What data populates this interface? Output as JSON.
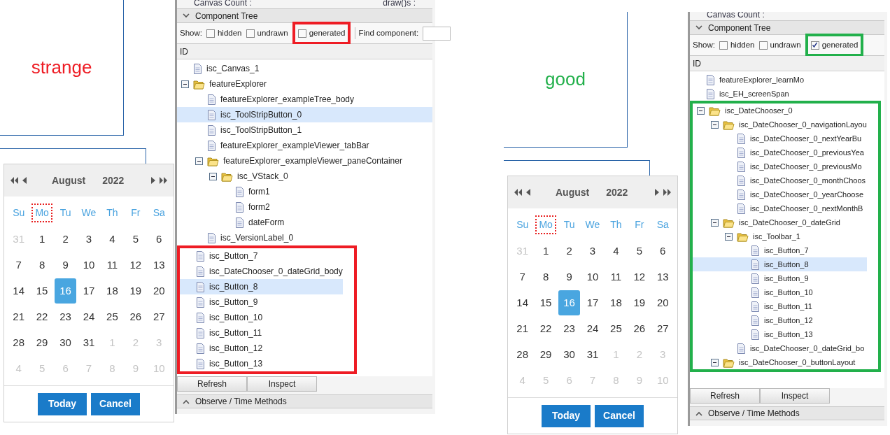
{
  "panels": [
    {
      "caption": {
        "text": "strange"
      },
      "color": "#ee1c24",
      "calendar": {
        "month": "August",
        "year": "2022",
        "weekdays": [
          {
            "label": "Su",
            "focused": false
          },
          {
            "label": "Mo",
            "focused": true
          },
          {
            "label": "Tu",
            "focused": false
          },
          {
            "label": "We",
            "focused": false
          },
          {
            "label": "Th",
            "focused": false
          },
          {
            "label": "Fr",
            "focused": false
          },
          {
            "label": "Sa",
            "focused": false
          }
        ],
        "weeks": [
          [
            {
              "day": "31",
              "other_month": true,
              "selected": false
            },
            {
              "day": "1",
              "other_month": false,
              "selected": false
            },
            {
              "day": "2",
              "other_month": false,
              "selected": false
            },
            {
              "day": "3",
              "other_month": false,
              "selected": false
            },
            {
              "day": "4",
              "other_month": false,
              "selected": false
            },
            {
              "day": "5",
              "other_month": false,
              "selected": false
            },
            {
              "day": "6",
              "other_month": false,
              "selected": false
            }
          ],
          [
            {
              "day": "7",
              "other_month": false,
              "selected": false
            },
            {
              "day": "8",
              "other_month": false,
              "selected": false
            },
            {
              "day": "9",
              "other_month": false,
              "selected": false
            },
            {
              "day": "10",
              "other_month": false,
              "selected": false
            },
            {
              "day": "11",
              "other_month": false,
              "selected": false
            },
            {
              "day": "12",
              "other_month": false,
              "selected": false
            },
            {
              "day": "13",
              "other_month": false,
              "selected": false
            }
          ],
          [
            {
              "day": "14",
              "other_month": false,
              "selected": false
            },
            {
              "day": "15",
              "other_month": false,
              "selected": false
            },
            {
              "day": "16",
              "other_month": false,
              "selected": true
            },
            {
              "day": "17",
              "other_month": false,
              "selected": false
            },
            {
              "day": "18",
              "other_month": false,
              "selected": false
            },
            {
              "day": "19",
              "other_month": false,
              "selected": false
            },
            {
              "day": "20",
              "other_month": false,
              "selected": false
            }
          ],
          [
            {
              "day": "21",
              "other_month": false,
              "selected": false
            },
            {
              "day": "22",
              "other_month": false,
              "selected": false
            },
            {
              "day": "23",
              "other_month": false,
              "selected": false
            },
            {
              "day": "24",
              "other_month": false,
              "selected": false
            },
            {
              "day": "25",
              "other_month": false,
              "selected": false
            },
            {
              "day": "26",
              "other_month": false,
              "selected": false
            },
            {
              "day": "27",
              "other_month": false,
              "selected": false
            }
          ],
          [
            {
              "day": "28",
              "other_month": false,
              "selected": false
            },
            {
              "day": "29",
              "other_month": false,
              "selected": false
            },
            {
              "day": "30",
              "other_month": false,
              "selected": false
            },
            {
              "day": "31",
              "other_month": false,
              "selected": false
            },
            {
              "day": "1",
              "other_month": true,
              "selected": false
            },
            {
              "day": "2",
              "other_month": true,
              "selected": false
            },
            {
              "day": "3",
              "other_month": true,
              "selected": false
            }
          ],
          [
            {
              "day": "4",
              "other_month": true,
              "selected": false
            },
            {
              "day": "5",
              "other_month": true,
              "selected": false
            },
            {
              "day": "6",
              "other_month": true,
              "selected": false
            },
            {
              "day": "7",
              "other_month": true,
              "selected": false
            },
            {
              "day": "8",
              "other_month": true,
              "selected": false
            },
            {
              "day": "9",
              "other_month": true,
              "selected": false
            },
            {
              "day": "10",
              "other_month": true,
              "selected": false
            }
          ]
        ],
        "buttons": [
          "Today",
          "Cancel"
        ]
      },
      "inspector": {
        "top_labels": [
          "Canvas Count :",
          "draw()s :"
        ],
        "section": "Component Tree",
        "show_label": "Show:",
        "show_options": [
          {
            "label": "hidden",
            "checked": false,
            "annotated": false
          },
          {
            "label": "undrawn",
            "checked": false,
            "annotated": false
          },
          {
            "label": "generated",
            "checked": false,
            "annotated": true
          }
        ],
        "find_label": "Find component:",
        "column": "ID",
        "tree": [
          {
            "label": "isc_Canvas_1",
            "kind": "leaf",
            "selected": false,
            "annotated": false
          },
          {
            "label": "featureExplorer",
            "kind": "folder",
            "expanded": true,
            "selected": false,
            "annotated": false,
            "children": [
              {
                "label": "featureExplorer_exampleTree_body",
                "kind": "leaf",
                "selected": false
              },
              {
                "label": "isc_ToolStripButton_0",
                "kind": "leaf",
                "selected": true
              },
              {
                "label": "isc_ToolStripButton_1",
                "kind": "leaf",
                "selected": false
              },
              {
                "label": "featureExplorer_exampleViewer_tabBar",
                "kind": "leaf",
                "selected": false
              },
              {
                "label": "featureExplorer_exampleViewer_paneContainer",
                "kind": "folder",
                "expanded": true,
                "selected": false,
                "children": [
                  {
                    "label": "isc_VStack_0",
                    "kind": "folder",
                    "expanded": true,
                    "selected": false,
                    "children": [
                      {
                        "label": "form1",
                        "kind": "leaf",
                        "selected": false
                      },
                      {
                        "label": "form2",
                        "kind": "leaf",
                        "selected": false
                      },
                      {
                        "label": "dateForm",
                        "kind": "leaf",
                        "selected": false
                      }
                    ]
                  }
                ]
              },
              {
                "label": "isc_VersionLabel_0",
                "kind": "leaf",
                "selected": false
              }
            ]
          },
          {
            "label": "isc_Button_7",
            "kind": "leaf",
            "selected": false,
            "annotated": true
          },
          {
            "label": "isc_DateChooser_0_dateGrid_body",
            "kind": "leaf",
            "selected": false,
            "annotated": true
          },
          {
            "label": "isc_Button_8",
            "kind": "leaf",
            "selected": true,
            "annotated": true
          },
          {
            "label": "isc_Button_9",
            "kind": "leaf",
            "selected": false,
            "annotated": true
          },
          {
            "label": "isc_Button_10",
            "kind": "leaf",
            "selected": false,
            "annotated": true
          },
          {
            "label": "isc_Button_11",
            "kind": "leaf",
            "selected": false,
            "annotated": true
          },
          {
            "label": "isc_Button_12",
            "kind": "leaf",
            "selected": false,
            "annotated": true
          },
          {
            "label": "isc_Button_13",
            "kind": "leaf",
            "selected": false,
            "annotated": true
          }
        ],
        "buttons": [
          "Refresh",
          "Inspect"
        ],
        "footer_section": "Observe / Time Methods"
      }
    },
    {
      "caption": {
        "text": "good"
      },
      "color": "#22b04b",
      "calendar": {
        "month": "August",
        "year": "2022",
        "weekdays": [
          {
            "label": "Su",
            "focused": false
          },
          {
            "label": "Mo",
            "focused": true
          },
          {
            "label": "Tu",
            "focused": false
          },
          {
            "label": "We",
            "focused": false
          },
          {
            "label": "Th",
            "focused": false
          },
          {
            "label": "Fr",
            "focused": false
          },
          {
            "label": "Sa",
            "focused": false
          }
        ],
        "weeks": [
          [
            {
              "day": "31",
              "other_month": true,
              "selected": false
            },
            {
              "day": "1",
              "other_month": false,
              "selected": false
            },
            {
              "day": "2",
              "other_month": false,
              "selected": false
            },
            {
              "day": "3",
              "other_month": false,
              "selected": false
            },
            {
              "day": "4",
              "other_month": false,
              "selected": false
            },
            {
              "day": "5",
              "other_month": false,
              "selected": false
            },
            {
              "day": "6",
              "other_month": false,
              "selected": false
            }
          ],
          [
            {
              "day": "7",
              "other_month": false,
              "selected": false
            },
            {
              "day": "8",
              "other_month": false,
              "selected": false
            },
            {
              "day": "9",
              "other_month": false,
              "selected": false
            },
            {
              "day": "10",
              "other_month": false,
              "selected": false
            },
            {
              "day": "11",
              "other_month": false,
              "selected": false
            },
            {
              "day": "12",
              "other_month": false,
              "selected": false
            },
            {
              "day": "13",
              "other_month": false,
              "selected": false
            }
          ],
          [
            {
              "day": "14",
              "other_month": false,
              "selected": false
            },
            {
              "day": "15",
              "other_month": false,
              "selected": false
            },
            {
              "day": "16",
              "other_month": false,
              "selected": true
            },
            {
              "day": "17",
              "other_month": false,
              "selected": false
            },
            {
              "day": "18",
              "other_month": false,
              "selected": false
            },
            {
              "day": "19",
              "other_month": false,
              "selected": false
            },
            {
              "day": "20",
              "other_month": false,
              "selected": false
            }
          ],
          [
            {
              "day": "21",
              "other_month": false,
              "selected": false
            },
            {
              "day": "22",
              "other_month": false,
              "selected": false
            },
            {
              "day": "23",
              "other_month": false,
              "selected": false
            },
            {
              "day": "24",
              "other_month": false,
              "selected": false
            },
            {
              "day": "25",
              "other_month": false,
              "selected": false
            },
            {
              "day": "26",
              "other_month": false,
              "selected": false
            },
            {
              "day": "27",
              "other_month": false,
              "selected": false
            }
          ],
          [
            {
              "day": "28",
              "other_month": false,
              "selected": false
            },
            {
              "day": "29",
              "other_month": false,
              "selected": false
            },
            {
              "day": "30",
              "other_month": false,
              "selected": false
            },
            {
              "day": "31",
              "other_month": false,
              "selected": false
            },
            {
              "day": "1",
              "other_month": true,
              "selected": false
            },
            {
              "day": "2",
              "other_month": true,
              "selected": false
            },
            {
              "day": "3",
              "other_month": true,
              "selected": false
            }
          ],
          [
            {
              "day": "4",
              "other_month": true,
              "selected": false
            },
            {
              "day": "5",
              "other_month": true,
              "selected": false
            },
            {
              "day": "6",
              "other_month": true,
              "selected": false
            },
            {
              "day": "7",
              "other_month": true,
              "selected": false
            },
            {
              "day": "8",
              "other_month": true,
              "selected": false
            },
            {
              "day": "9",
              "other_month": true,
              "selected": false
            },
            {
              "day": "10",
              "other_month": true,
              "selected": false
            }
          ]
        ],
        "buttons": [
          "Today",
          "Cancel"
        ]
      },
      "inspector": {
        "top_labels": [
          "Canvas Count :"
        ],
        "section": "Component Tree",
        "show_label": "Show:",
        "show_options": [
          {
            "label": "hidden",
            "checked": false,
            "annotated": false
          },
          {
            "label": "undrawn",
            "checked": false,
            "annotated": false
          },
          {
            "label": "generated",
            "checked": true,
            "annotated": true
          }
        ],
        "column": "ID",
        "tree": [
          {
            "label": "featureExplorer_learnMo",
            "kind": "leaf",
            "selected": false,
            "annotated": false
          },
          {
            "label": "isc_EH_screenSpan",
            "kind": "leaf",
            "selected": false,
            "annotated": false
          },
          {
            "label": "isc_DateChooser_0",
            "kind": "folder",
            "expanded": true,
            "selected": false,
            "annotated": true,
            "children": [
              {
                "label": "isc_DateChooser_0_navigationLayou",
                "kind": "folder",
                "expanded": true,
                "selected": false,
                "children": [
                  {
                    "label": "isc_DateChooser_0_nextYearBu",
                    "kind": "leaf",
                    "selected": false
                  },
                  {
                    "label": "isc_DateChooser_0_previousYea",
                    "kind": "leaf",
                    "selected": false
                  },
                  {
                    "label": "isc_DateChooser_0_previousMo",
                    "kind": "leaf",
                    "selected": false
                  },
                  {
                    "label": "isc_DateChooser_0_monthChoos",
                    "kind": "leaf",
                    "selected": false
                  },
                  {
                    "label": "isc_DateChooser_0_yearChoose",
                    "kind": "leaf",
                    "selected": false
                  },
                  {
                    "label": "isc_DateChooser_0_nextMonthB",
                    "kind": "leaf",
                    "selected": false
                  }
                ]
              },
              {
                "label": "isc_DateChooser_0_dateGrid",
                "kind": "folder",
                "expanded": true,
                "selected": false,
                "children": [
                  {
                    "label": "isc_Toolbar_1",
                    "kind": "folder",
                    "expanded": true,
                    "selected": false,
                    "children": [
                      {
                        "label": "isc_Button_7",
                        "kind": "leaf",
                        "selected": false
                      },
                      {
                        "label": "isc_Button_8",
                        "kind": "leaf",
                        "selected": true
                      },
                      {
                        "label": "isc_Button_9",
                        "kind": "leaf",
                        "selected": false
                      },
                      {
                        "label": "isc_Button_10",
                        "kind": "leaf",
                        "selected": false
                      },
                      {
                        "label": "isc_Button_11",
                        "kind": "leaf",
                        "selected": false
                      },
                      {
                        "label": "isc_Button_12",
                        "kind": "leaf",
                        "selected": false
                      },
                      {
                        "label": "isc_Button_13",
                        "kind": "leaf",
                        "selected": false
                      }
                    ]
                  },
                  {
                    "label": "isc_DateChooser_0_dateGrid_bo",
                    "kind": "leaf",
                    "selected": false
                  }
                ]
              },
              {
                "label": "isc_DateChooser_0_buttonLayout",
                "kind": "folder",
                "expanded": true,
                "selected": false
              }
            ]
          }
        ],
        "buttons": [
          "Refresh",
          "Inspect"
        ],
        "footer_section": "Observe / Time Methods"
      }
    }
  ]
}
